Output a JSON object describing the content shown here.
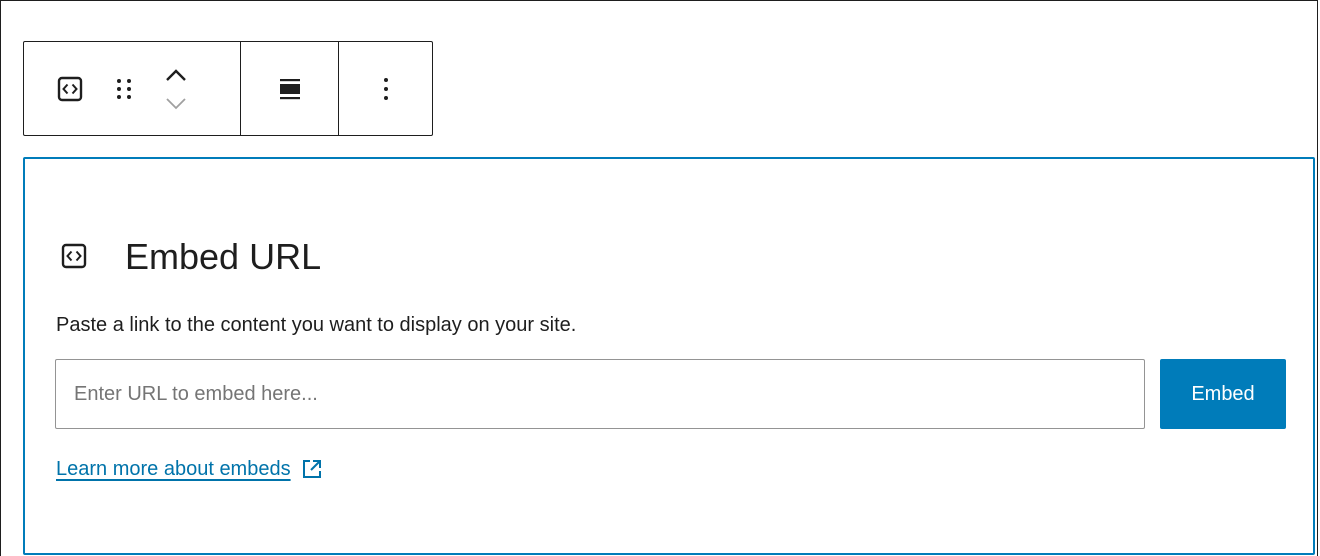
{
  "toolbar": {
    "block_icon": "embed-block-icon",
    "drag_icon": "drag-handle-icon",
    "move_up_icon": "chevron-up-icon",
    "move_down_icon": "chevron-down-icon",
    "align_icon": "align-wide-icon",
    "options_icon": "more-vertical-icon"
  },
  "placeholder": {
    "icon": "embed-block-icon",
    "title": "Embed URL",
    "instructions": "Paste a link to the content you want to display on your site.",
    "input": {
      "value": "",
      "placeholder": "Enter URL to embed here..."
    },
    "submit_label": "Embed",
    "learn_more_label": "Learn more about embeds",
    "learn_more_icon": "external-link-icon"
  },
  "colors": {
    "accent": "#007cba",
    "link": "#0073aa",
    "text": "#1e1e1e",
    "border": "#1e1e1e",
    "muted": "#757575"
  }
}
